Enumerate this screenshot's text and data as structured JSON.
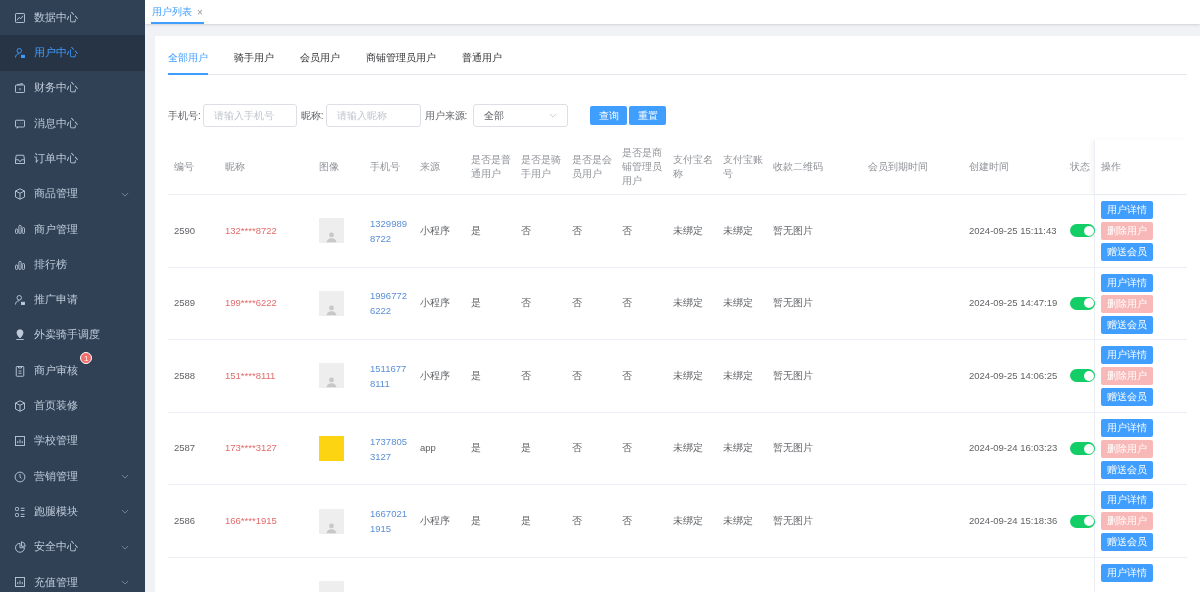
{
  "sidebar": {
    "items": [
      {
        "label": "数据中心",
        "kind": "chart",
        "selected": false,
        "expandable": false
      },
      {
        "label": "用户中心",
        "kind": "user",
        "selected": true,
        "expandable": false
      },
      {
        "label": "财务中心",
        "kind": "wallet",
        "selected": false,
        "expandable": false
      },
      {
        "label": "消息中心",
        "kind": "message",
        "selected": false,
        "expandable": false
      },
      {
        "label": "订单中心",
        "kind": "inbox",
        "selected": false,
        "expandable": false
      },
      {
        "label": "商品管理",
        "kind": "box",
        "selected": false,
        "expandable": true
      },
      {
        "label": "商户管理",
        "kind": "bars",
        "selected": false,
        "expandable": false
      },
      {
        "label": "排行榜",
        "kind": "bars",
        "selected": false,
        "expandable": false
      },
      {
        "label": "推广申请",
        "kind": "user",
        "selected": false,
        "expandable": false
      },
      {
        "label": "外卖骑手调度",
        "kind": "pin",
        "selected": false,
        "expandable": false
      },
      {
        "label": "商户审核",
        "kind": "clipboard",
        "selected": false,
        "expandable": false,
        "badge": "1"
      },
      {
        "label": "首页装修",
        "kind": "box",
        "selected": false,
        "expandable": false
      },
      {
        "label": "学校管理",
        "kind": "board",
        "selected": false,
        "expandable": false
      },
      {
        "label": "营销管理",
        "kind": "clock",
        "selected": false,
        "expandable": true
      },
      {
        "label": "跑腿模块",
        "kind": "list",
        "selected": false,
        "expandable": true
      },
      {
        "label": "安全中心",
        "kind": "pie",
        "selected": false,
        "expandable": true
      },
      {
        "label": "充值管理",
        "kind": "board",
        "selected": false,
        "expandable": true
      }
    ]
  },
  "page_tabs": [
    {
      "label": "用户列表",
      "close": "×",
      "selected": true
    }
  ],
  "user_tabs": [
    {
      "label": "全部用户",
      "selected": true
    },
    {
      "label": "骑手用户",
      "selected": false
    },
    {
      "label": "会员用户",
      "selected": false
    },
    {
      "label": "商铺管理员用户",
      "selected": false
    },
    {
      "label": "普通用户",
      "selected": false
    }
  ],
  "filters": {
    "phone": {
      "label": "手机号:",
      "placeholder": "请输入手机号"
    },
    "nickname": {
      "label": "昵称:",
      "placeholder": "请输入昵称"
    },
    "source": {
      "label": "用户来源:",
      "value": "全部"
    },
    "buttons": [
      "查询",
      "重置"
    ]
  },
  "table": {
    "columns": [
      "编号",
      "昵称",
      "图像",
      "手机号",
      "来源",
      "是否是普通用户",
      "是否是骑手用户",
      "是否是会员用户",
      "是否是商铺管理员用户",
      "支付宝名称",
      "支付宝账号",
      "收款二维码",
      "会员到期时间",
      "创建时间",
      "状态",
      "操作"
    ],
    "rows": [
      {
        "kind": "default",
        "id": "2590",
        "nickname": "132****8722",
        "phone": "13299898722",
        "source": "小程序",
        "normal": "是",
        "rider": "否",
        "member": "否",
        "admin": "否",
        "alipay_name": "未绑定",
        "alipay_account": "未绑定",
        "qr": "暂无图片",
        "created": "2024-09-25 15:11:43",
        "status_on": true,
        "actions": [
          "用户详情",
          "删除用户",
          "赠送会员"
        ]
      },
      {
        "kind": "default",
        "id": "2589",
        "nickname": "199****6222",
        "phone": "19967726222",
        "source": "小程序",
        "normal": "是",
        "rider": "否",
        "member": "否",
        "admin": "否",
        "alipay_name": "未绑定",
        "alipay_account": "未绑定",
        "qr": "暂无图片",
        "created": "2024-09-25 14:47:19",
        "status_on": true,
        "actions": [
          "用户详情",
          "删除用户",
          "赠送会员"
        ]
      },
      {
        "kind": "default",
        "id": "2588",
        "nickname": "151****8111",
        "phone": "15116778111",
        "source": "小程序",
        "normal": "是",
        "rider": "否",
        "member": "否",
        "admin": "否",
        "alipay_name": "未绑定",
        "alipay_account": "未绑定",
        "qr": "暂无图片",
        "created": "2024-09-25 14:06:25",
        "status_on": true,
        "actions": [
          "用户详情",
          "删除用户",
          "赠送会员"
        ]
      },
      {
        "kind": "logo",
        "id": "2587",
        "nickname": "173****3127",
        "phone": "17378053127",
        "source": "app",
        "normal": "是",
        "rider": "是",
        "member": "否",
        "admin": "否",
        "alipay_name": "未绑定",
        "alipay_account": "未绑定",
        "qr": "暂无图片",
        "created": "2024-09-24 16:03:23",
        "status_on": true,
        "actions": [
          "用户详情",
          "删除用户",
          "赠送会员"
        ]
      },
      {
        "kind": "default",
        "id": "2586",
        "nickname": "166****1915",
        "phone": "16670211915",
        "source": "小程序",
        "normal": "是",
        "rider": "是",
        "member": "否",
        "admin": "否",
        "alipay_name": "未绑定",
        "alipay_account": "未绑定",
        "qr": "暂无图片",
        "created": "2024-09-24 15:18:36",
        "status_on": true,
        "actions": [
          "用户详情",
          "删除用户",
          "赠送会员"
        ]
      },
      {
        "kind": "default",
        "actions": [
          "用户详情"
        ]
      }
    ]
  }
}
